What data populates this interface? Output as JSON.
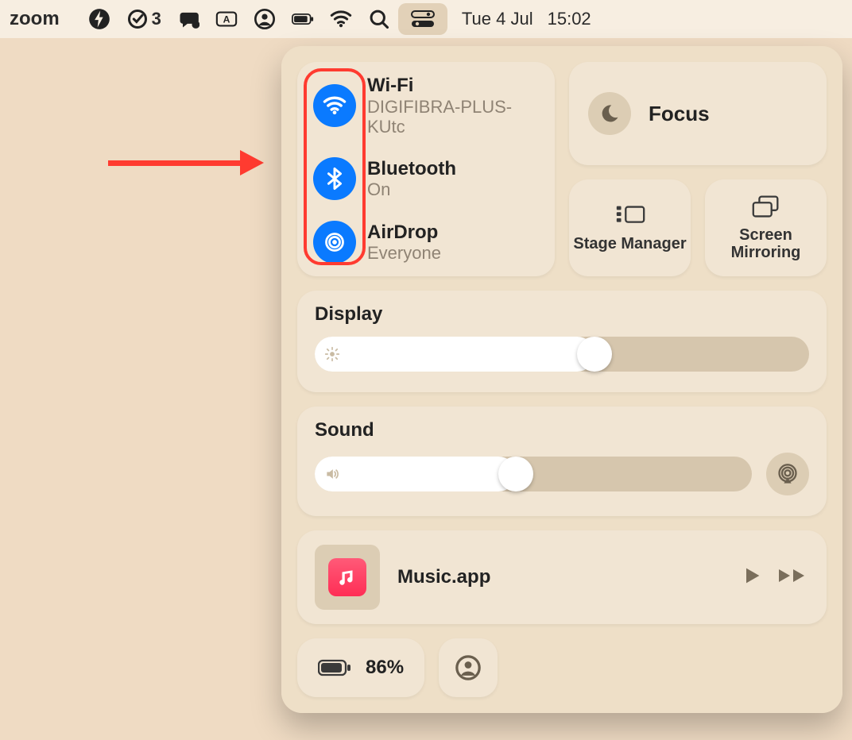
{
  "menubar": {
    "app": "zoom",
    "todo_count": "3",
    "date": "Tue 4 Jul",
    "time": "15:02"
  },
  "connectivity": {
    "wifi": {
      "title": "Wi-Fi",
      "sub": "DIGIFIBRA-PLUS-KUtc"
    },
    "bt": {
      "title": "Bluetooth",
      "sub": "On"
    },
    "airdrop": {
      "title": "AirDrop",
      "sub": "Everyone"
    }
  },
  "focus": {
    "label": "Focus"
  },
  "tiles": {
    "stage": "Stage Manager",
    "mirror": "Screen Mirroring"
  },
  "display": {
    "title": "Display",
    "percent": 53
  },
  "sound": {
    "title": "Sound",
    "percent": 42
  },
  "music": {
    "label": "Music.app"
  },
  "battery": {
    "label": "86%"
  }
}
